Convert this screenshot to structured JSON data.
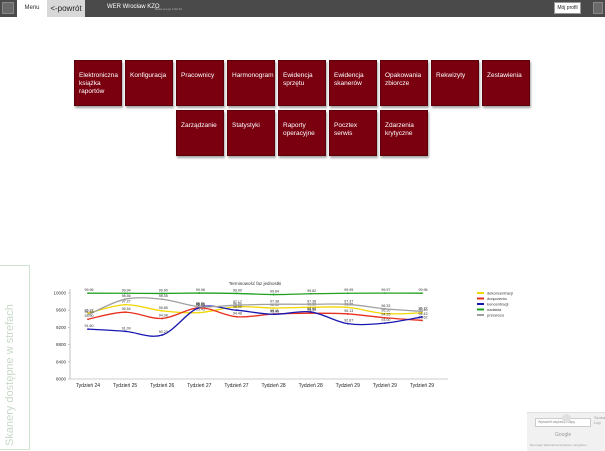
{
  "topbar": {
    "tab_menu": "Menu",
    "tab_back": "<-powrót",
    "title": "WER Wrocław KZO",
    "subtitle": "Baza ver pp 1.02.13",
    "profile_label": "Mój profil"
  },
  "tiles": [
    {
      "label": "Elektroniczna książka raportów"
    },
    {
      "label": "Konfiguracja"
    },
    {
      "label": "Pracownicy"
    },
    {
      "label": "Harmonogram"
    },
    {
      "label": "Ewidencja sprzętu"
    },
    {
      "label": "Ewidencja skanerów"
    },
    {
      "label": "Opakowania zbiorcze"
    },
    {
      "label": "Rekwizyty"
    },
    {
      "label": "Zestawienia"
    },
    {
      "label": "Zarządzanie"
    },
    {
      "label": "Statystyki"
    },
    {
      "label": "Raporty operacyjne"
    },
    {
      "label": "Pocztex serwis"
    },
    {
      "label": "Zdarzenia krytyczne"
    }
  ],
  "side_panel": {
    "label": "Skanery dostępne w strefach"
  },
  "map": {
    "search_placeholder": "Wyświetl większą mapę",
    "brand": "Google",
    "footer": "Na mapie   Warunki korzystania z programu",
    "cut_text": "Szuka\nLop"
  },
  "chart_data": {
    "type": "line",
    "title": "Terminowość faz jednostki",
    "categories": [
      "Tydzień 24",
      "Tydzień 25",
      "Tydzień 26",
      "Tydzień 27",
      "Tydzień 27",
      "Tydzień 28",
      "Tydzień 28",
      "Tydzień 29",
      "Tydzień 29",
      "Tydzień 29"
    ],
    "ylim": [
      8000,
      10000
    ],
    "yticks": [
      "10000",
      "9600",
      "9200",
      "8800",
      "8400",
      "8000"
    ],
    "grid": false,
    "legend_position": "right",
    "series": [
      {
        "name": "dekoncentracji",
        "color": "#f2d600",
        "values": [
          9527,
          9727,
          9585,
          9543,
          9680,
          9650,
          9668,
          9665,
          9520,
          9540
        ],
        "labels": [
          "95.27",
          "97.27",
          "95.85",
          "95.43",
          "96.80",
          "96.50",
          "96.68",
          "96.65",
          "95.20",
          "95.40"
        ]
      },
      {
        "name": "doręczenia",
        "color": "#e83020",
        "values": [
          9390,
          9554,
          9408,
          9655,
          9448,
          9511,
          9530,
          9513,
          9425,
          9362
        ],
        "labels": [
          "93.90",
          "95.54",
          "94.08",
          "96.55",
          "94.48",
          "95.11",
          "95.30",
          "95.13",
          "94.25",
          "93.62"
        ]
      },
      {
        "name": "koncentracji",
        "color": "#1818b0",
        "values": [
          9160,
          9109,
          9023,
          9663,
          9600,
          9505,
          9560,
          9287,
          9300,
          9443
        ],
        "labels": [
          "91.60",
          "91.09",
          "90.23",
          "96.63",
          "96.00",
          "95.05",
          "95.60",
          "92.87",
          "93.00",
          "94.43"
        ]
      },
      {
        "name": "nadania",
        "color": "#20a020",
        "values": [
          9996,
          9994,
          9990,
          9998,
          9990,
          9964,
          9982,
          9995,
          9997,
          9996
        ],
        "labels": [
          "99.96",
          "99.94",
          "99.90",
          "99.98",
          "99.90",
          "99.64",
          "99.82",
          "99.95",
          "99.97",
          "99.96"
        ]
      },
      {
        "name": "przewozu",
        "color": "#a0a0a0",
        "values": [
          9493,
          9856,
          9855,
          9681,
          9717,
          9738,
          9738,
          9737,
          9633,
          9572
        ],
        "labels": [
          "94.93",
          "98.56",
          "98.55",
          "96.81",
          "97.17",
          "97.38",
          "97.38",
          "97.37",
          "96.33",
          "95.72"
        ]
      }
    ]
  }
}
